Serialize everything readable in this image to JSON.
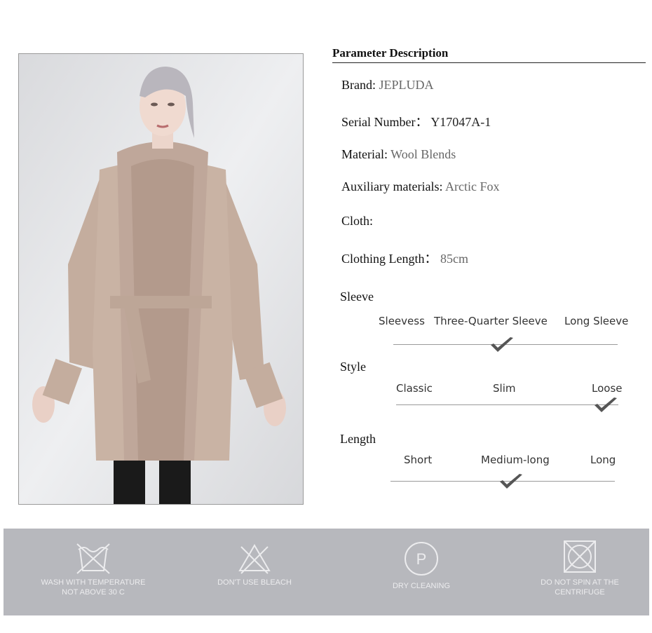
{
  "heading": "Parameter Description",
  "params": {
    "brand_label": "Brand:",
    "brand_value": "JEPLUDA",
    "serial_label": "Serial Number：",
    "serial_value": "Y17047A-1",
    "material_label": "Material:",
    "material_value": "Wool Blends",
    "aux_label": "Auxiliary  materials:",
    "aux_value": "Arctic Fox",
    "cloth_label": "Cloth:",
    "length_label": "Clothing Length：",
    "length_value": "85cm"
  },
  "scales": {
    "sleeve": {
      "title": "Sleeve",
      "options": [
        "Sleevess",
        "Three-Quarter Sleeve",
        "Long Sleeve"
      ],
      "selected": "Three-Quarter Sleeve"
    },
    "style": {
      "title": "Style",
      "options": [
        "Classic",
        "Slim",
        "Loose"
      ],
      "selected": "Loose"
    },
    "length": {
      "title": "Length",
      "options": [
        "Short",
        "Medium-long",
        "Long"
      ],
      "selected": "Medium-long"
    }
  },
  "care": [
    {
      "icon": "wash-30-icon",
      "line1": "WASH WITH TEMPERATURE",
      "line2": "NOT ABOVE 30 C"
    },
    {
      "icon": "no-bleach-icon",
      "line1": "DON'T USE BLEACH",
      "line2": ""
    },
    {
      "icon": "dry-clean-icon",
      "line1": "DRY CLEANING",
      "line2": "",
      "symbol": "P"
    },
    {
      "icon": "no-tumble-dry-icon",
      "line1": "DO NOT SPIN AT THE",
      "line2": "CENTRIFUGE"
    }
  ],
  "colors": {
    "care_band": "#b7b8bd",
    "value_text": "#666666",
    "coat": "#c9b3a4",
    "fur": "#bfa79a"
  }
}
